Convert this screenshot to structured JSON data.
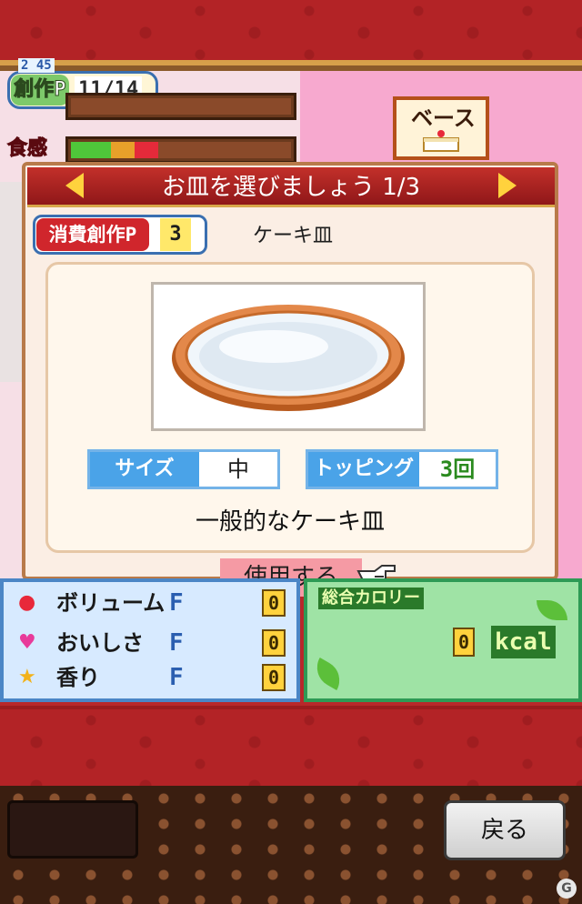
{
  "status": {
    "souzou_label": "創作P",
    "souzou_value": "11/14",
    "souzou_small": "2 45",
    "shokkan_label": "食感"
  },
  "base_button": {
    "label": "ベース"
  },
  "dialog": {
    "title": "お皿を選びましょう 1/3",
    "cost_label": "消費創作P",
    "cost_value": "3",
    "plate_name": "ケーキ皿",
    "size_label": "サイズ",
    "size_value": "中",
    "topping_label": "トッピング",
    "topping_value": "3回",
    "description": "一般的なケーキ皿",
    "use_button": "使用する"
  },
  "params": [
    {
      "name": "ボリューム",
      "rank": "F",
      "value": "0",
      "icon": "apple-icon"
    },
    {
      "name": "おいしさ",
      "rank": "F",
      "value": "0",
      "icon": "heart-icon"
    },
    {
      "name": "香り",
      "rank": "F",
      "value": "0",
      "icon": "star-icon"
    }
  ],
  "calorie": {
    "label": "総合カロリー",
    "value": "0",
    "unit": "kcal"
  },
  "footer": {
    "back_button": "戻る",
    "logo": "G"
  },
  "colors": {
    "curtain": "#b32326",
    "dialog_header": "#c3302a",
    "highlight": "#f59aa4"
  }
}
